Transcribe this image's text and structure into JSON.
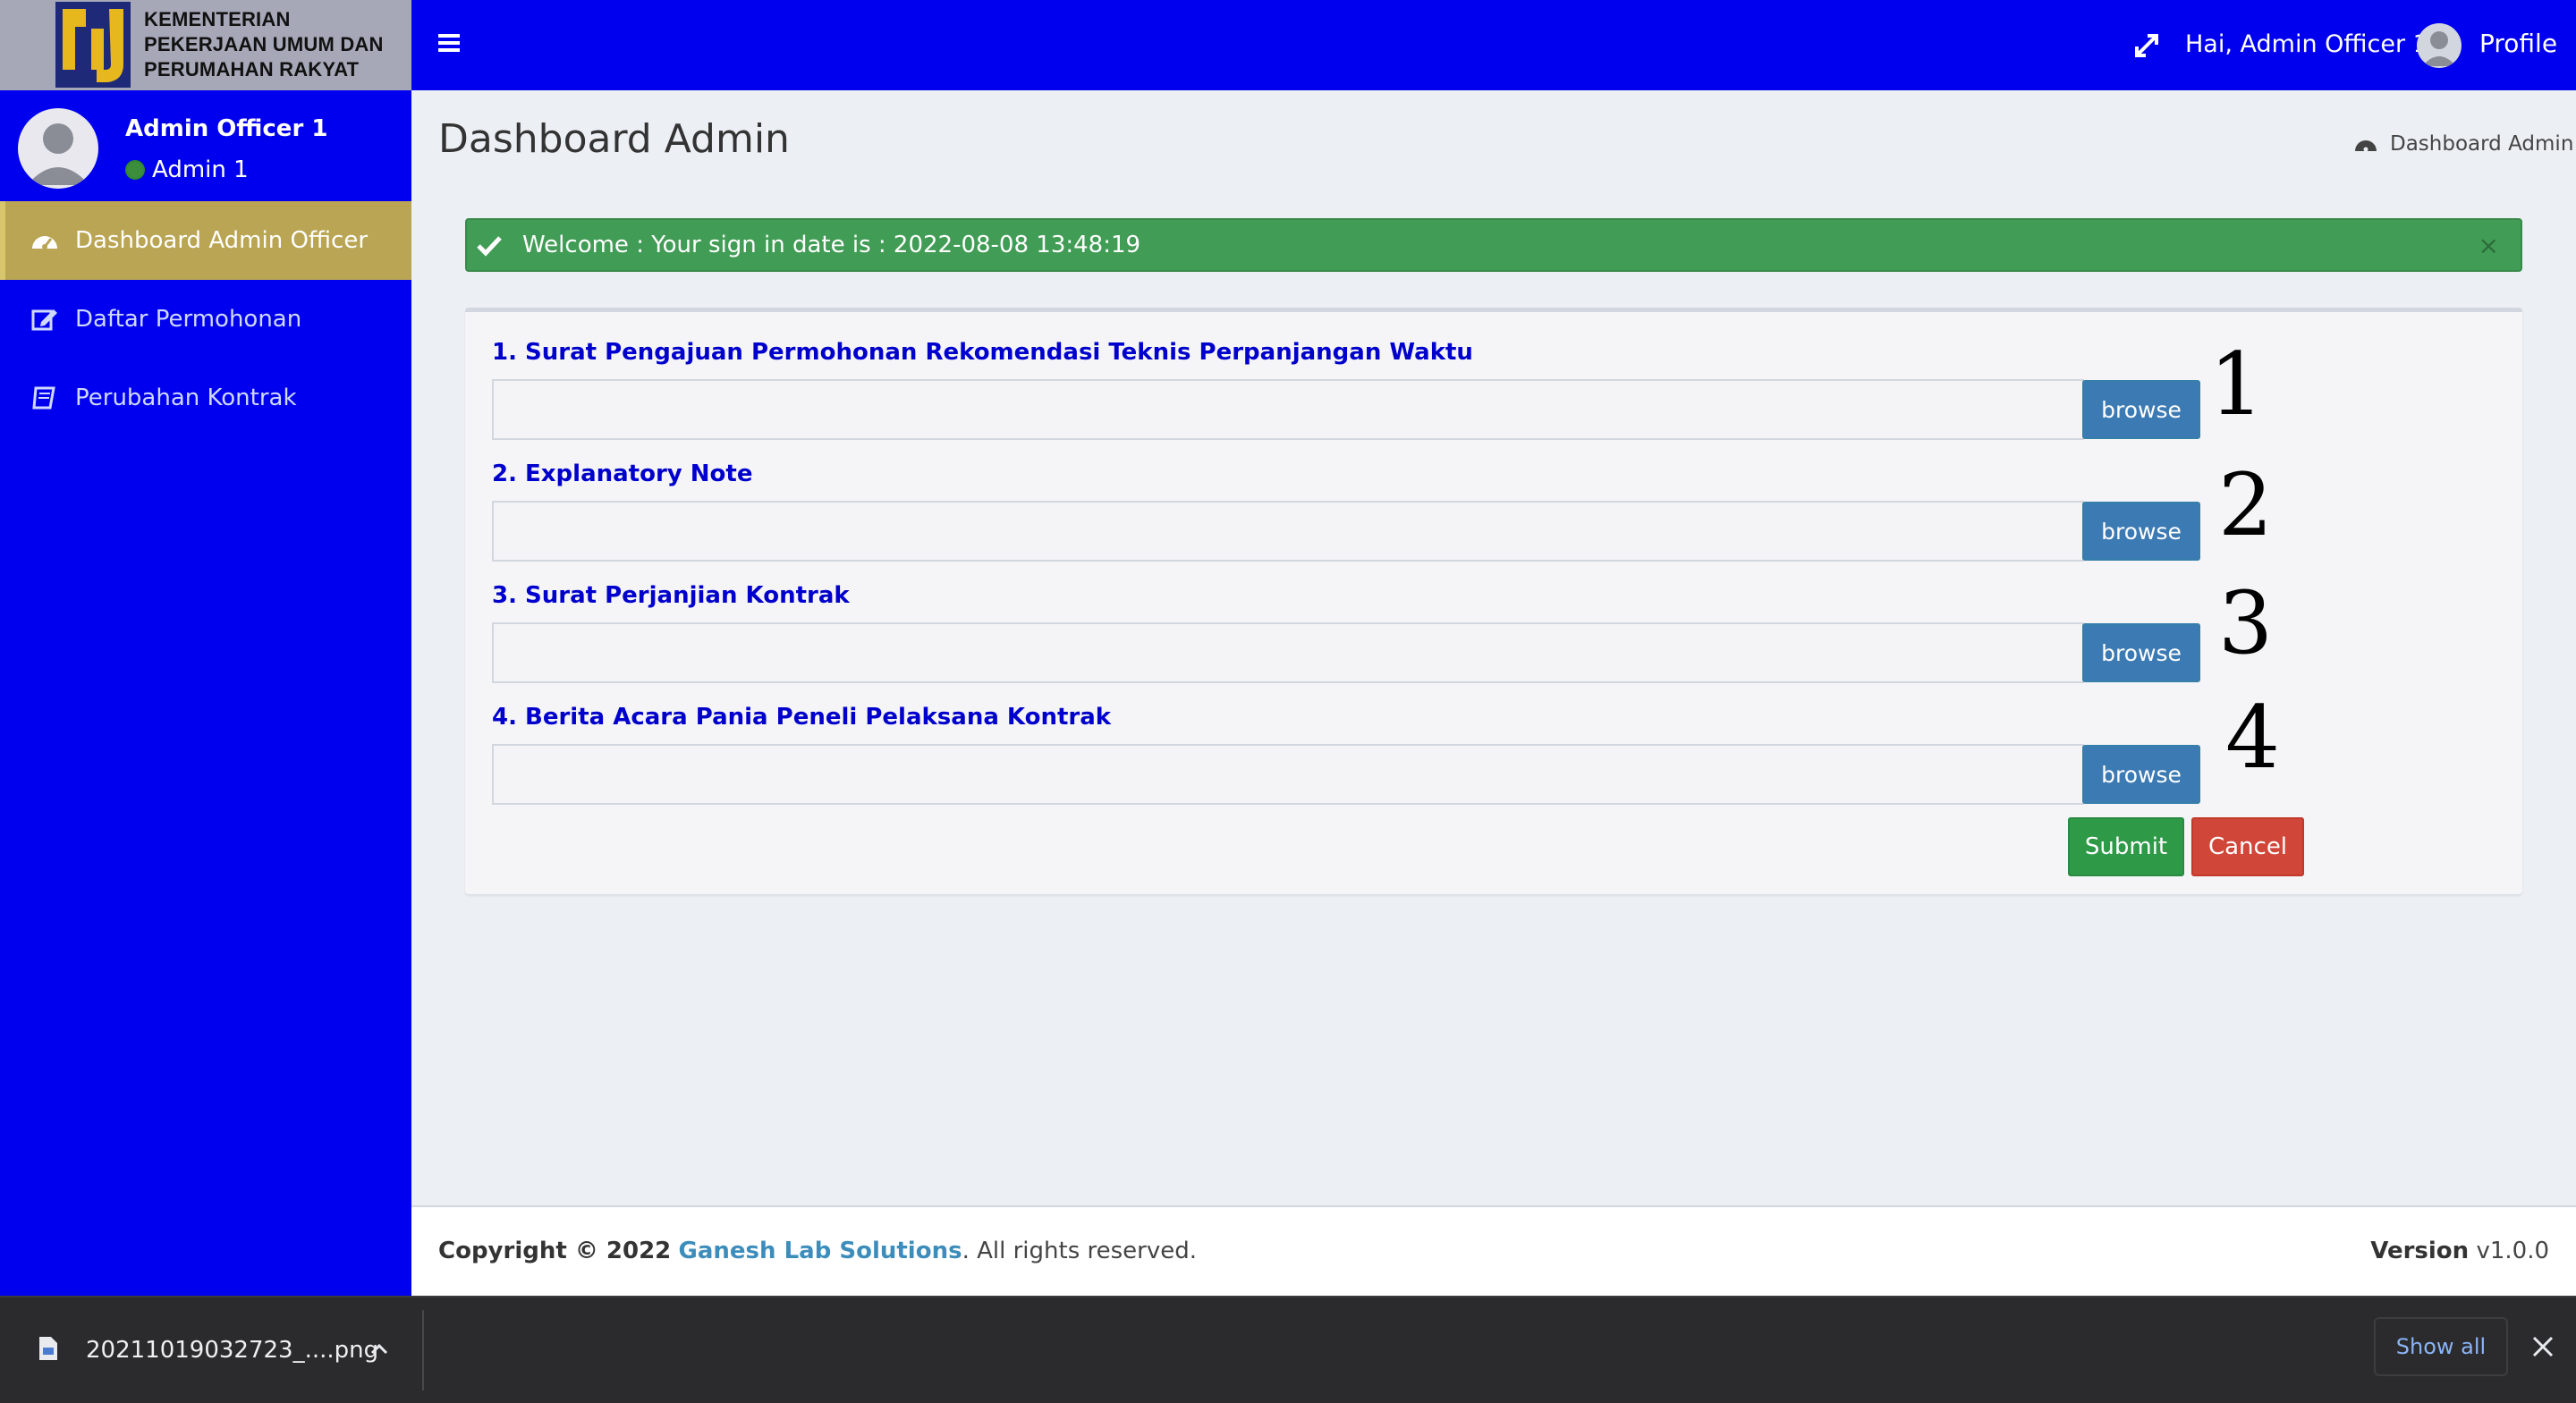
{
  "header": {
    "logo_line1": "KEMENTERIAN",
    "logo_line2": "PEKERJAAN UMUM DAN",
    "logo_line3": "PERUMAHAN RAKYAT",
    "greeting": "Hai, Admin Officer 1",
    "profile_label": "Profile",
    "menu_icon": "hamburger-icon",
    "expand_icon": "expand-icon"
  },
  "sidebar": {
    "user_name": "Admin Officer 1",
    "user_role": "Admin 1",
    "items": [
      {
        "label": "Dashboard Admin Officer",
        "icon": "dashboard-icon",
        "active": true
      },
      {
        "label": "Daftar Permohonan",
        "icon": "edit-icon",
        "active": false
      },
      {
        "label": "Perubahan Kontrak",
        "icon": "book-icon",
        "active": false
      }
    ]
  },
  "content": {
    "title": "Dashboard Admin",
    "breadcrumb": "Dashboard Admin",
    "alert": "Welcome : Your sign in date is : 2022-08-08 13:48:19",
    "alert_close": "×",
    "fields": [
      {
        "label": "1. Surat Pengajuan Permohonan Rekomendasi Teknis Perpanjangan Waktu",
        "value": "",
        "button": "browse",
        "annotation": "1"
      },
      {
        "label": "2. Explanatory Note",
        "value": "",
        "button": "browse",
        "annotation": "2"
      },
      {
        "label": "3. Surat Perjanjian Kontrak",
        "value": "",
        "button": "browse",
        "annotation": "3"
      },
      {
        "label": "4. Berita Acara Pania Peneli Pelaksana Kontrak",
        "value": "",
        "button": "browse",
        "annotation": "4"
      }
    ],
    "submit_label": "Submit",
    "cancel_label": "Cancel"
  },
  "footer": {
    "copyright_prefix": "Copyright © 2022",
    "brand": "Ganesh Lab Solutions",
    "suffix": ". All rights reserved.",
    "version_label": "Version",
    "version_value": "v1.0.0"
  },
  "download_bar": {
    "filename": "20211019032723_....png",
    "show_all": "Show all"
  },
  "colors": {
    "primary_blue": "#0000ee",
    "active_menu": "#b9a553",
    "alert_green": "#419c55",
    "browse_blue": "#3c7ab4",
    "submit_green": "#2e9a48",
    "cancel_red": "#d0473a",
    "label_blue": "#0000cc"
  }
}
